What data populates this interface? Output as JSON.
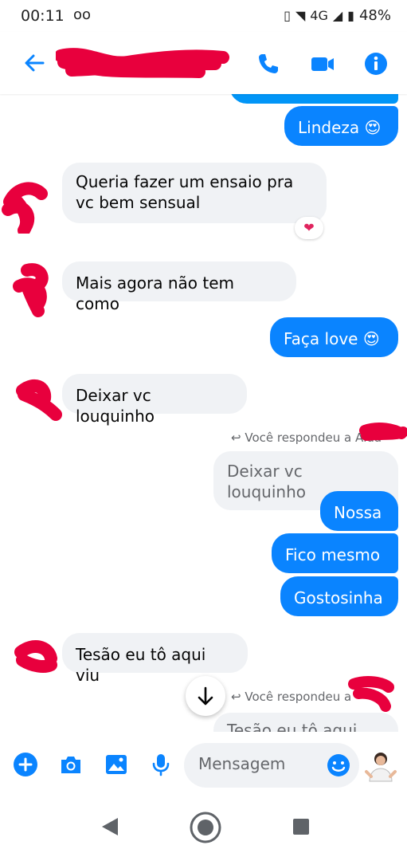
{
  "status_bar": {
    "time": "00:11",
    "network": "4G",
    "battery": "48%"
  },
  "header": {
    "contact_name": ""
  },
  "messages": {
    "m1": "Lindeza 😍",
    "m2": "Queria fazer um ensaio pra vc bem sensual",
    "m2_reaction": "❤",
    "m3": "Mais agora não tem como",
    "m4": "Faça love 😍",
    "m5": "Deixar vc louquinho",
    "reply1_label": "Você respondeu a Alda",
    "reply1_quote": "Deixar vc louquinho",
    "m6": "Nossa",
    "m7": "Fico mesmo",
    "m8": "Gostosinha",
    "m9": "Tesão eu tô aqui viu",
    "reply2_label": "Você respondeu a",
    "reply2_quote": "Tesão eu tô aqui viu"
  },
  "composer": {
    "placeholder": "Mensagem"
  },
  "icons": {
    "back": "arrow-left-icon",
    "call": "phone-icon",
    "video": "video-camera-icon",
    "info": "info-icon",
    "plus": "plus-icon",
    "camera": "camera-icon",
    "gallery": "image-icon",
    "mic": "microphone-icon",
    "emoji": "smiley-icon",
    "scroll": "arrow-down-icon"
  },
  "colors": {
    "accent": "#0a84ff",
    "redaction": "#e8003d",
    "incoming_bg": "#f0f2f5"
  }
}
